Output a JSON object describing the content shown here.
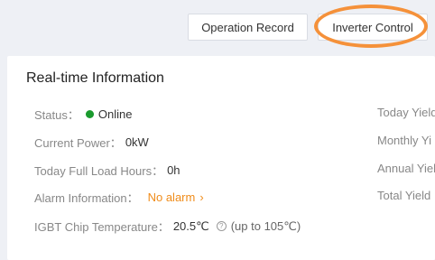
{
  "toolbar": {
    "operation_record": "Operation Record",
    "inverter_control": "Inverter Control"
  },
  "card": {
    "title": "Real-time Information",
    "status": {
      "label": "Status：",
      "value": "Online",
      "color": "#1a9a2e"
    },
    "current_power": {
      "label": "Current Power：",
      "value": "0kW"
    },
    "full_load_hours": {
      "label": "Today Full Load Hours：",
      "value": "0h"
    },
    "alarm": {
      "label": "Alarm Information：",
      "value": "No alarm",
      "color": "#f08c1a"
    },
    "igbt": {
      "label": "IGBT Chip Temperature：",
      "value": "20.5℃",
      "note": "(up to 105℃)"
    },
    "right": {
      "today_yield": "Today Yield",
      "monthly_yield": "Monthly Yi",
      "annual_yield": "Annual Yiel",
      "total_yield": "Total Yield"
    }
  },
  "highlight_color": "#f5913a"
}
